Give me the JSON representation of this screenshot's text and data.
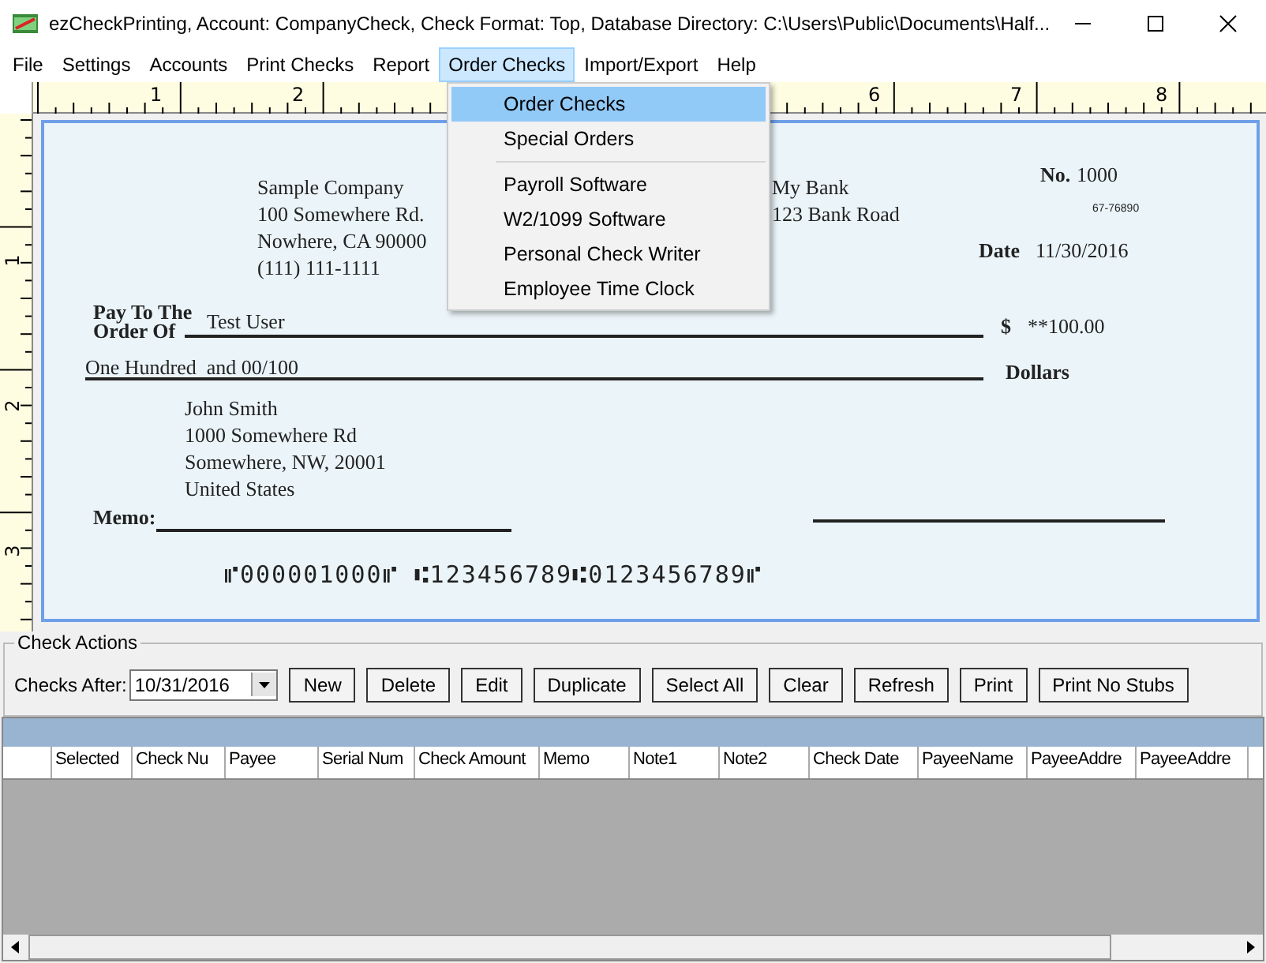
{
  "window": {
    "title": "ezCheckPrinting, Account: CompanyCheck, Check Format: Top, Database Directory: C:\\Users\\Public\\Documents\\Half..."
  },
  "menu": [
    {
      "label": "File",
      "selected": false
    },
    {
      "label": "Settings",
      "selected": false
    },
    {
      "label": "Accounts",
      "selected": false
    },
    {
      "label": "Print Checks",
      "selected": false
    },
    {
      "label": "Report",
      "selected": false
    },
    {
      "label": "Order Checks",
      "selected": true
    },
    {
      "label": "Import/Export",
      "selected": false
    },
    {
      "label": "Help",
      "selected": false
    }
  ],
  "dropdown": {
    "groups": [
      [
        {
          "label": "Order Checks",
          "selected": true
        },
        {
          "label": "Special Orders",
          "selected": false
        }
      ],
      [
        {
          "label": "Payroll Software",
          "selected": false
        },
        {
          "label": "W2/1099 Software",
          "selected": false
        },
        {
          "label": "Personal Check Writer",
          "selected": false
        },
        {
          "label": "Employee Time Clock",
          "selected": false
        }
      ]
    ]
  },
  "ruler": {
    "horizontal": [
      "1",
      "2",
      "6",
      "7",
      "8"
    ],
    "vertical": [
      "1",
      "2",
      "3"
    ]
  },
  "check": {
    "company": [
      "Sample Company",
      "100 Somewhere Rd.",
      "Nowhere, CA 90000",
      "(111) 111-1111"
    ],
    "bank": [
      "My Bank",
      "123 Bank Road"
    ],
    "number_label": "No.",
    "number": "1000",
    "routing_fraction": "67-76890",
    "date_label": "Date",
    "date": "11/30/2016",
    "pay_to_label": [
      "Pay To The",
      "Order Of"
    ],
    "payee": "Test User",
    "currency": "$",
    "amount": "**100.00",
    "amount_words": "One Hundred  and 00/100",
    "dollars_label": "Dollars",
    "payee_address": [
      "John Smith",
      "1000 Somewhere Rd",
      "Somewhere, NW, 20001",
      "United States"
    ],
    "memo_label": "Memo:",
    "micr": "⑈000001000⑈ ⑆123456789⑆0123456789⑈"
  },
  "check_actions": {
    "title": "Check Actions",
    "checks_after_label": "Checks After:",
    "checks_after": "10/31/2016",
    "buttons": [
      "New",
      "Delete",
      "Edit",
      "Duplicate",
      "Select All",
      "Clear",
      "Refresh",
      "Print",
      "Print No Stubs"
    ]
  },
  "table": {
    "columns": [
      "Selected",
      "Check Nu",
      "Payee",
      "Serial Num",
      "Check Amount",
      "Memo",
      "Note1",
      "Note2",
      "Check Date",
      "PayeeName",
      "PayeeAddre",
      "PayeeAddre"
    ]
  }
}
